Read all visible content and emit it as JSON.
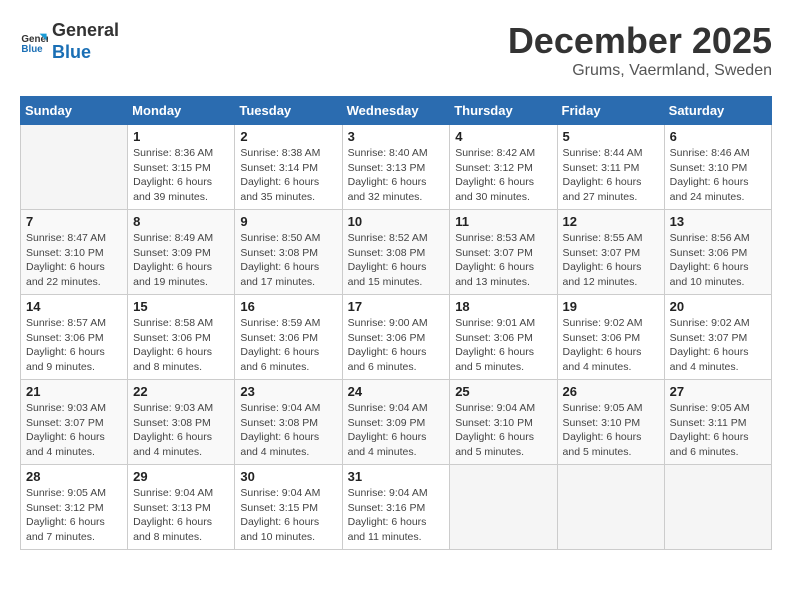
{
  "logo": {
    "line1": "General",
    "line2": "Blue"
  },
  "title": "December 2025",
  "subtitle": "Grums, Vaermland, Sweden",
  "days_of_week": [
    "Sunday",
    "Monday",
    "Tuesday",
    "Wednesday",
    "Thursday",
    "Friday",
    "Saturday"
  ],
  "weeks": [
    [
      {
        "day": "",
        "info": ""
      },
      {
        "day": "1",
        "info": "Sunrise: 8:36 AM\nSunset: 3:15 PM\nDaylight: 6 hours\nand 39 minutes."
      },
      {
        "day": "2",
        "info": "Sunrise: 8:38 AM\nSunset: 3:14 PM\nDaylight: 6 hours\nand 35 minutes."
      },
      {
        "day": "3",
        "info": "Sunrise: 8:40 AM\nSunset: 3:13 PM\nDaylight: 6 hours\nand 32 minutes."
      },
      {
        "day": "4",
        "info": "Sunrise: 8:42 AM\nSunset: 3:12 PM\nDaylight: 6 hours\nand 30 minutes."
      },
      {
        "day": "5",
        "info": "Sunrise: 8:44 AM\nSunset: 3:11 PM\nDaylight: 6 hours\nand 27 minutes."
      },
      {
        "day": "6",
        "info": "Sunrise: 8:46 AM\nSunset: 3:10 PM\nDaylight: 6 hours\nand 24 minutes."
      }
    ],
    [
      {
        "day": "7",
        "info": "Sunrise: 8:47 AM\nSunset: 3:10 PM\nDaylight: 6 hours\nand 22 minutes."
      },
      {
        "day": "8",
        "info": "Sunrise: 8:49 AM\nSunset: 3:09 PM\nDaylight: 6 hours\nand 19 minutes."
      },
      {
        "day": "9",
        "info": "Sunrise: 8:50 AM\nSunset: 3:08 PM\nDaylight: 6 hours\nand 17 minutes."
      },
      {
        "day": "10",
        "info": "Sunrise: 8:52 AM\nSunset: 3:08 PM\nDaylight: 6 hours\nand 15 minutes."
      },
      {
        "day": "11",
        "info": "Sunrise: 8:53 AM\nSunset: 3:07 PM\nDaylight: 6 hours\nand 13 minutes."
      },
      {
        "day": "12",
        "info": "Sunrise: 8:55 AM\nSunset: 3:07 PM\nDaylight: 6 hours\nand 12 minutes."
      },
      {
        "day": "13",
        "info": "Sunrise: 8:56 AM\nSunset: 3:06 PM\nDaylight: 6 hours\nand 10 minutes."
      }
    ],
    [
      {
        "day": "14",
        "info": "Sunrise: 8:57 AM\nSunset: 3:06 PM\nDaylight: 6 hours\nand 9 minutes."
      },
      {
        "day": "15",
        "info": "Sunrise: 8:58 AM\nSunset: 3:06 PM\nDaylight: 6 hours\nand 8 minutes."
      },
      {
        "day": "16",
        "info": "Sunrise: 8:59 AM\nSunset: 3:06 PM\nDaylight: 6 hours\nand 6 minutes."
      },
      {
        "day": "17",
        "info": "Sunrise: 9:00 AM\nSunset: 3:06 PM\nDaylight: 6 hours\nand 6 minutes."
      },
      {
        "day": "18",
        "info": "Sunrise: 9:01 AM\nSunset: 3:06 PM\nDaylight: 6 hours\nand 5 minutes."
      },
      {
        "day": "19",
        "info": "Sunrise: 9:02 AM\nSunset: 3:06 PM\nDaylight: 6 hours\nand 4 minutes."
      },
      {
        "day": "20",
        "info": "Sunrise: 9:02 AM\nSunset: 3:07 PM\nDaylight: 6 hours\nand 4 minutes."
      }
    ],
    [
      {
        "day": "21",
        "info": "Sunrise: 9:03 AM\nSunset: 3:07 PM\nDaylight: 6 hours\nand 4 minutes."
      },
      {
        "day": "22",
        "info": "Sunrise: 9:03 AM\nSunset: 3:08 PM\nDaylight: 6 hours\nand 4 minutes."
      },
      {
        "day": "23",
        "info": "Sunrise: 9:04 AM\nSunset: 3:08 PM\nDaylight: 6 hours\nand 4 minutes."
      },
      {
        "day": "24",
        "info": "Sunrise: 9:04 AM\nSunset: 3:09 PM\nDaylight: 6 hours\nand 4 minutes."
      },
      {
        "day": "25",
        "info": "Sunrise: 9:04 AM\nSunset: 3:10 PM\nDaylight: 6 hours\nand 5 minutes."
      },
      {
        "day": "26",
        "info": "Sunrise: 9:05 AM\nSunset: 3:10 PM\nDaylight: 6 hours\nand 5 minutes."
      },
      {
        "day": "27",
        "info": "Sunrise: 9:05 AM\nSunset: 3:11 PM\nDaylight: 6 hours\nand 6 minutes."
      }
    ],
    [
      {
        "day": "28",
        "info": "Sunrise: 9:05 AM\nSunset: 3:12 PM\nDaylight: 6 hours\nand 7 minutes."
      },
      {
        "day": "29",
        "info": "Sunrise: 9:04 AM\nSunset: 3:13 PM\nDaylight: 6 hours\nand 8 minutes."
      },
      {
        "day": "30",
        "info": "Sunrise: 9:04 AM\nSunset: 3:15 PM\nDaylight: 6 hours\nand 10 minutes."
      },
      {
        "day": "31",
        "info": "Sunrise: 9:04 AM\nSunset: 3:16 PM\nDaylight: 6 hours\nand 11 minutes."
      },
      {
        "day": "",
        "info": ""
      },
      {
        "day": "",
        "info": ""
      },
      {
        "day": "",
        "info": ""
      }
    ]
  ]
}
